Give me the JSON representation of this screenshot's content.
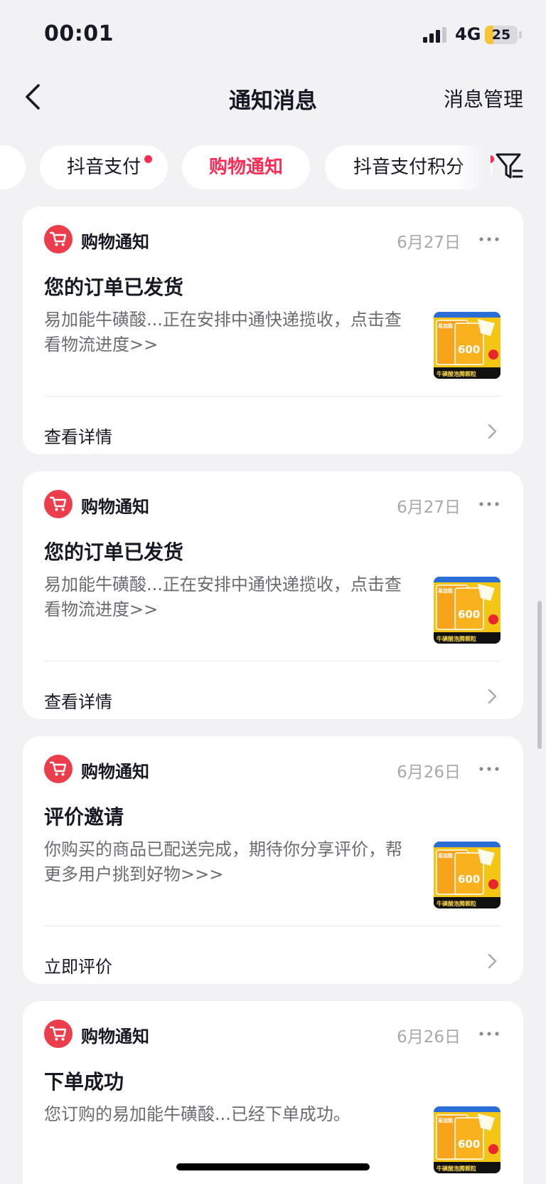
{
  "status_bar": {
    "time": "00:01",
    "network": "4G",
    "battery_level": 25,
    "battery_text": "25"
  },
  "nav": {
    "title": "通知消息",
    "right_action": "消息管理"
  },
  "tabs": [
    {
      "label": "",
      "active": false,
      "has_dot": false
    },
    {
      "label": "抖音支付",
      "active": false,
      "has_dot": true
    },
    {
      "label": "购物通知",
      "active": true,
      "has_dot": false
    },
    {
      "label": "抖音支付积分",
      "active": false,
      "has_dot": true
    }
  ],
  "cards": [
    {
      "source": "购物通知",
      "date": "6月27日",
      "title": "您的订单已发货",
      "body": "易加能牛磺酸...正在安排中通快递揽收，点击查看物流进度>>",
      "action": "查看详情",
      "icon": "cart-icon"
    },
    {
      "source": "购物通知",
      "date": "6月27日",
      "title": "您的订单已发货",
      "body": "易加能牛磺酸...正在安排中通快递揽收，点击查看物流进度>>",
      "action": "查看详情",
      "icon": "cart-icon"
    },
    {
      "source": "购物通知",
      "date": "6月26日",
      "title": "评价邀请",
      "body": "你购买的商品已配送完成，期待你分享评价，帮更多用户挑到好物>>>",
      "action": "立即评价",
      "icon": "cart-icon"
    },
    {
      "source": "购物通知",
      "date": "6月26日",
      "title": "下单成功",
      "body": "您订购的易加能牛磺酸...已经下单成功。",
      "action": "",
      "icon": "cart-icon"
    }
  ],
  "product_thumb": {
    "brand": "易加能",
    "number": "600",
    "strip_text": "牛磺酸泡腾颗粒"
  },
  "colors": {
    "accent": "#fe2c55",
    "cart_badge": "#ec3d4c",
    "background": "#f2f2f5",
    "thumb_yellow": "#f3c515"
  }
}
